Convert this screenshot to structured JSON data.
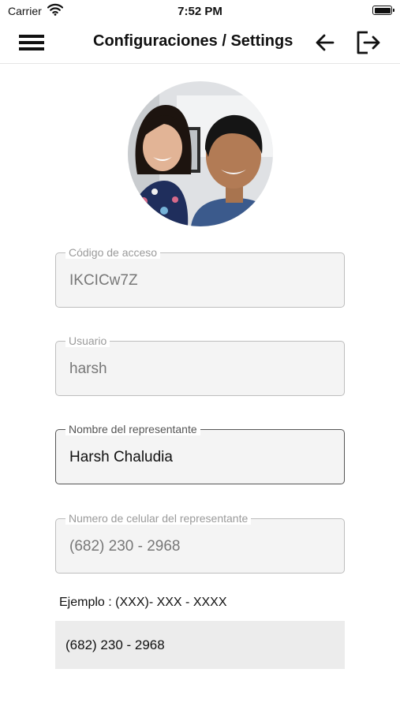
{
  "status_bar": {
    "carrier": "Carrier",
    "time": "7:52 PM",
    "icons": [
      "wifi-icon",
      "battery-icon"
    ]
  },
  "header": {
    "title": "Configuraciones / Settings",
    "icons": [
      "menu-icon",
      "back-arrow-icon",
      "logout-icon"
    ]
  },
  "profile": {
    "photo": "profile-photo"
  },
  "form": {
    "access_code": {
      "label": "Código de acceso",
      "value": "IKCICw7Z"
    },
    "username": {
      "label": "Usuario",
      "value": "harsh"
    },
    "representative_name": {
      "label": "Nombre del representante",
      "value": "Harsh Chaludia"
    },
    "representative_phone": {
      "label": "Numero de celular del representante",
      "value": "(682) 230 - 2968"
    }
  },
  "example_text": "Ejemplo : (XXX)- XXX - XXXX",
  "phone_display": "(682) 230 - 2968",
  "colors": {
    "field_background": "#f4f4f4",
    "field_border": "#bdbdbd",
    "phone_box_background": "#ececec"
  }
}
